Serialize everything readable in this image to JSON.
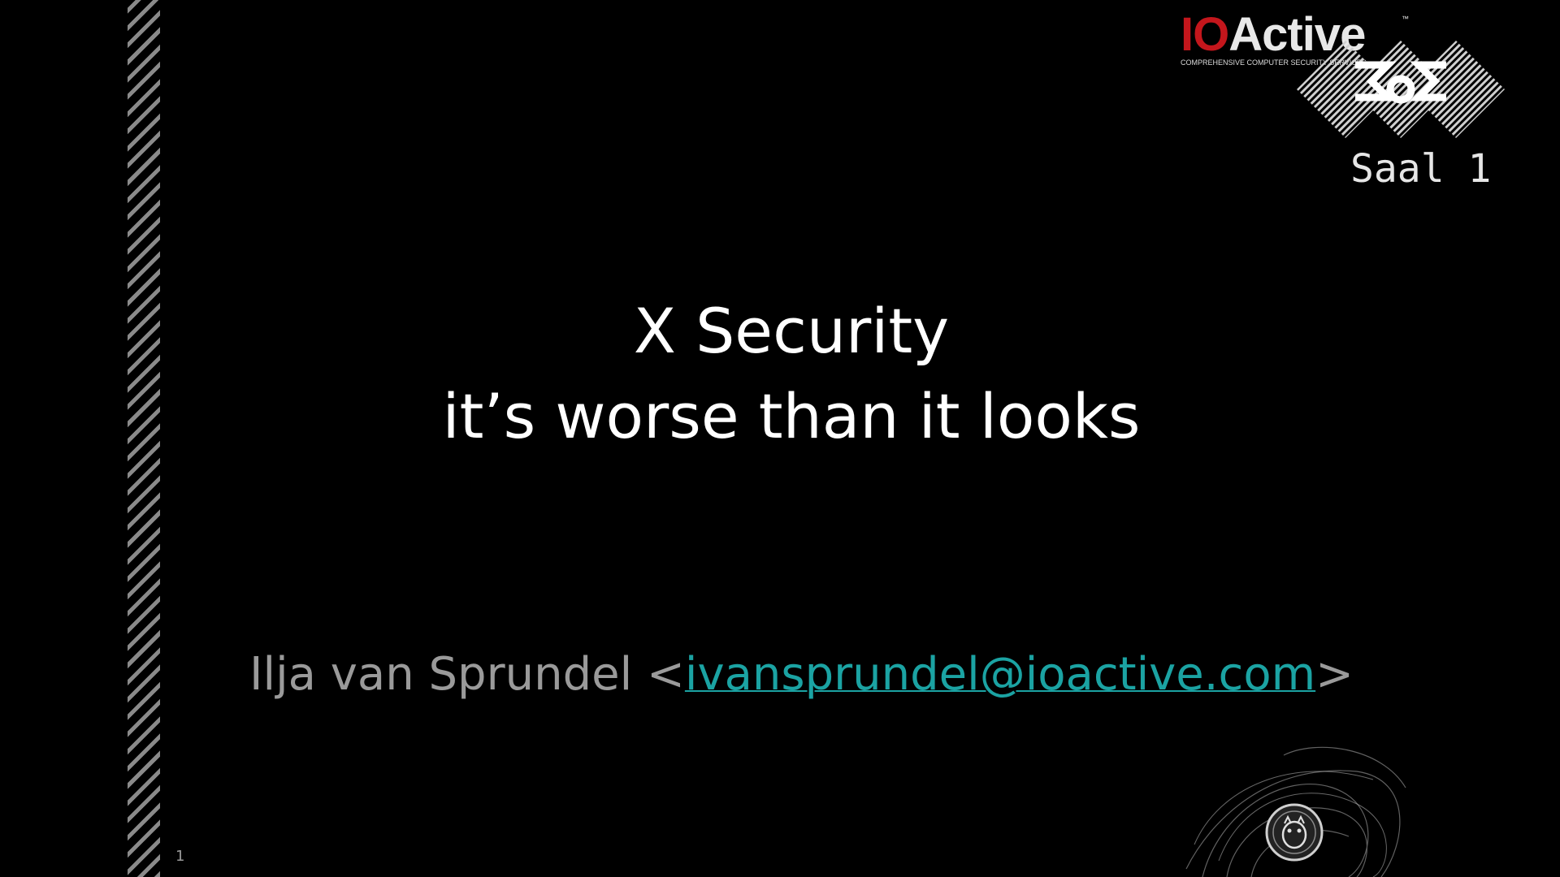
{
  "slide": {
    "title_line1": "X Security",
    "title_line2": "it’s worse than it looks",
    "author_prefix": "Ilja van Sprundel <",
    "author_email": "ivansprundel@ioactive.com",
    "author_suffix": ">",
    "slide_number": "1"
  },
  "branding": {
    "ioactive_io": "IO",
    "ioactive_rest": "Active",
    "ioactive_tm": "™",
    "ioactive_tagline": "COMPREHENSIVE COMPUTER SECURITY SERVICES",
    "room_label": "Saal 1"
  },
  "colors": {
    "background": "#000000",
    "title": "#ffffff",
    "author": "#9a9a9a",
    "link": "#1ba3a3",
    "brand_red": "#c4161c"
  },
  "icons": {
    "congress": "congress-diamond-logo-icon",
    "ornament": "smoke-swirl-ornament-icon"
  }
}
